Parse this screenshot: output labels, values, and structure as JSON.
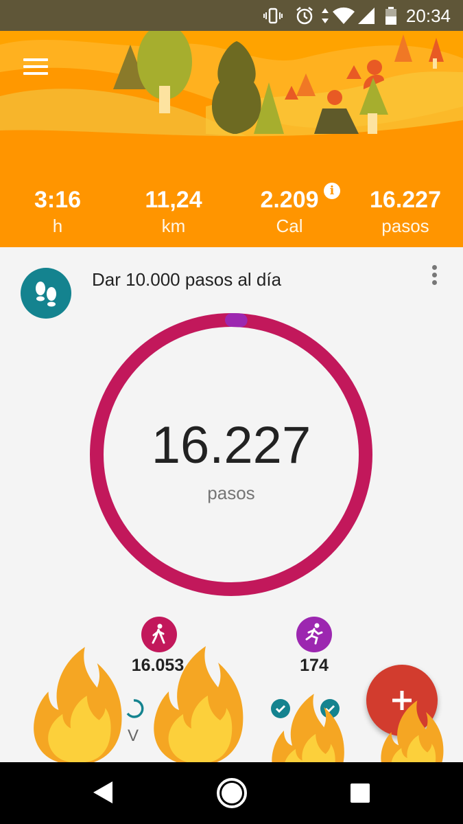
{
  "status_bar": {
    "time": "20:34",
    "icons": [
      "vibrate-icon",
      "alarm-icon",
      "data-arrows-icon",
      "wifi-icon",
      "signal-icon",
      "battery-icon"
    ]
  },
  "header": {
    "menu_icon": "menu-icon",
    "stats": [
      {
        "value": "3:16",
        "unit": "h"
      },
      {
        "value": "11,24",
        "unit": "km"
      },
      {
        "value": "2.209",
        "unit": "Cal",
        "info_icon": "i"
      },
      {
        "value": "16.227",
        "unit": "pasos"
      }
    ]
  },
  "goal": {
    "icon": "footsteps-icon",
    "title": "Dar 10.000 pasos al día",
    "ring_value": "16.227",
    "ring_unit": "pasos",
    "progress": 1.0
  },
  "activities": [
    {
      "icon": "walking-icon",
      "value": "16.053",
      "color": "#c2185b"
    },
    {
      "icon": "running-icon",
      "value": "174",
      "color": "#9c27b0"
    }
  ],
  "week": {
    "visible_day_label": "V"
  },
  "colors": {
    "header": "#ff9500",
    "ring": "#c2185b",
    "ring_accent": "#9c27b0",
    "goal_icon_bg": "#14838f",
    "fab": "#d23c2e",
    "check": "#14838f"
  },
  "nav_bar": {
    "icons": [
      "back-icon",
      "home-icon",
      "recents-icon"
    ]
  },
  "overlay": {
    "stickers": "fire-icon"
  }
}
